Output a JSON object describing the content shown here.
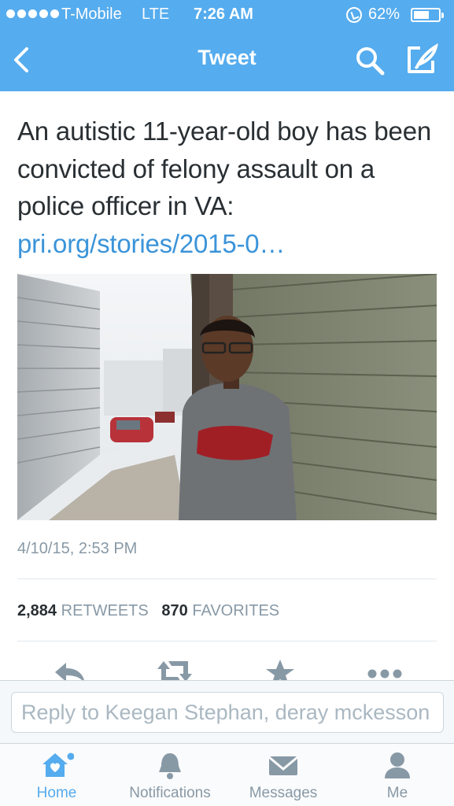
{
  "status_bar": {
    "carrier": "T-Mobile",
    "network": "LTE",
    "time": "7:26 AM",
    "battery_percent": "62%",
    "battery_level": 0.62
  },
  "nav": {
    "title": "Tweet",
    "back_icon": "chevron-left-icon",
    "search_icon": "search-icon",
    "compose_icon": "compose-icon"
  },
  "tweet": {
    "text": "An autistic 11-year-old boy has been convicted of felony assault on a police officer in VA: ",
    "link_text": "pri.org/stories/2015-0…",
    "timestamp": "4/10/15, 2:53 PM",
    "retweets_count": "2,884",
    "retweets_label": "RETWEETS",
    "favorites_count": "870",
    "favorites_label": "FAVORITES",
    "actions": [
      "reply-icon",
      "retweet-icon",
      "star-icon",
      "more-icon"
    ]
  },
  "reply": {
    "placeholder": "Reply to Keegan Stephan, deray mckesson"
  },
  "tabs": [
    {
      "label": "Home",
      "icon": "home-icon",
      "active": true
    },
    {
      "label": "Notifications",
      "icon": "bell-icon",
      "active": false
    },
    {
      "label": "Messages",
      "icon": "envelope-icon",
      "active": false
    },
    {
      "label": "Me",
      "icon": "person-icon",
      "active": false
    }
  ],
  "colors": {
    "brand": "#55acee",
    "link": "#3b94d9",
    "muted": "#8899a6",
    "text": "#292f33"
  }
}
